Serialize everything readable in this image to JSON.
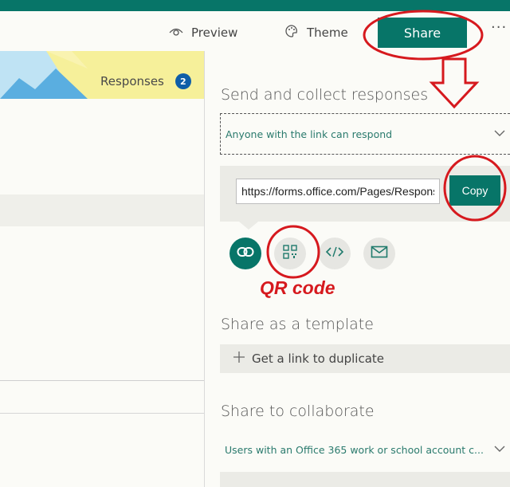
{
  "toolbar": {
    "preview_label": "Preview",
    "theme_label": "Theme",
    "share_label": "Share",
    "more_label": "···"
  },
  "form": {
    "responses_label": "Responses",
    "responses_count": "2"
  },
  "share_panel": {
    "send_title": "Send and collect responses",
    "respond_scope": "Anyone with the link can respond",
    "link_url": "https://forms.office.com/Pages/ResponsePage.aspx",
    "copy_label": "Copy",
    "share_methods": [
      "link-icon",
      "qr-code-icon",
      "embed-code-icon",
      "email-icon"
    ],
    "template_title": "Share as a template",
    "duplicate_label": "Get a link to duplicate",
    "collaborate_title": "Share to collaborate",
    "collaborate_scope": "Users with an Office 365 work or school account c..."
  },
  "annotation": {
    "qr_label": "QR code"
  },
  "colors": {
    "accent": "#077568",
    "annotation_red": "#d6191e",
    "badge": "#0f5ea8",
    "banner": "#f6f09a"
  }
}
